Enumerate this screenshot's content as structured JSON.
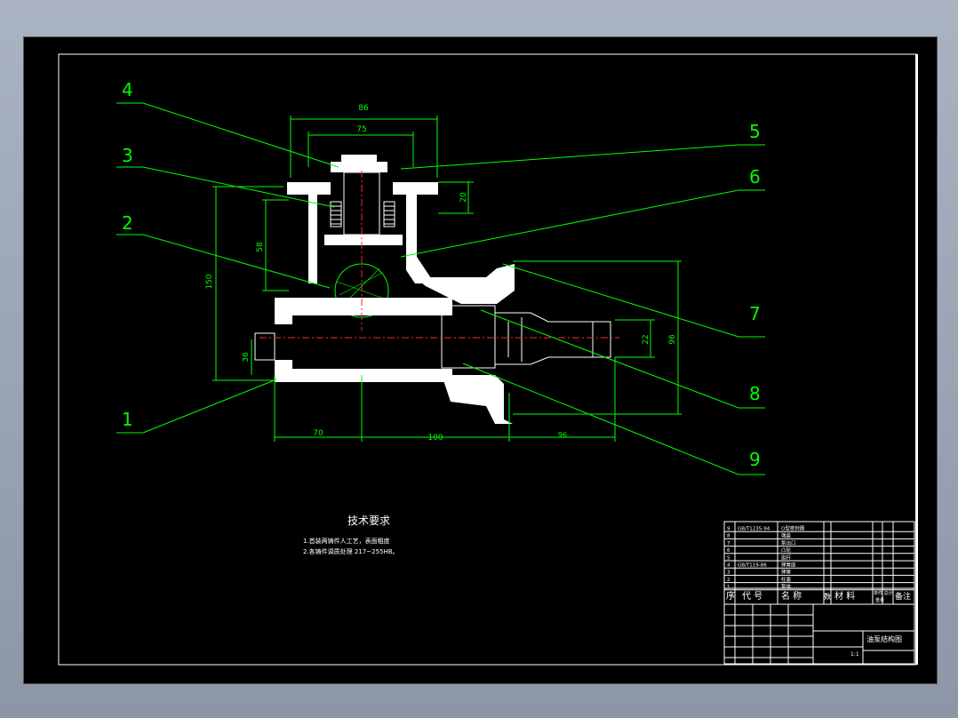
{
  "callouts": [
    "4",
    "5",
    "3",
    "6",
    "2",
    "7",
    "1",
    "8",
    "9"
  ],
  "dimensions": {
    "top_outer": "86",
    "top_inner": "75",
    "flange_thickness": "20",
    "spring_height": "58",
    "overall_height": "150",
    "bore": "36",
    "bottom_left": "70",
    "bottom_mid": "100",
    "bottom_right": "96",
    "outlet_dia": "22",
    "right_height": "96"
  },
  "notes": {
    "title": "技术要求",
    "line1": "1.首装两铸件人工艺，表面粗度",
    "line2": "2.各铸件调质处理  217~255HB。"
  },
  "title_block": {
    "header_seq": "序",
    "header_code": "代  号",
    "header_name": "名  称",
    "header_qty": "数",
    "header_material": "材  料",
    "header_weight": "单件 总计",
    "header_weight_sub": "重量",
    "header_remark": "备注",
    "drawing_name": "油泵结构图",
    "scale": "1:1",
    "rows": [
      {
        "no": "9",
        "code": "GB/T1235-94",
        "name": "O型密封圈"
      },
      {
        "no": "8",
        "code": "",
        "name": "端盖"
      },
      {
        "no": "7",
        "code": "",
        "name": "泵出口"
      },
      {
        "no": "6",
        "code": "",
        "name": "凸轮"
      },
      {
        "no": "5",
        "code": "",
        "name": "挺杆"
      },
      {
        "no": "4",
        "code": "GB/T119-86",
        "name": "弹簧座"
      },
      {
        "no": "3",
        "code": "",
        "name": "弹簧"
      },
      {
        "no": "2",
        "code": "",
        "name": "柱塞"
      },
      {
        "no": "1",
        "code": "",
        "name": "泵体"
      }
    ]
  },
  "colors": {
    "annotation": "#00ff00",
    "outline": "#ffffff",
    "centerline": "#ff2a2a",
    "sheet": "#000000"
  }
}
